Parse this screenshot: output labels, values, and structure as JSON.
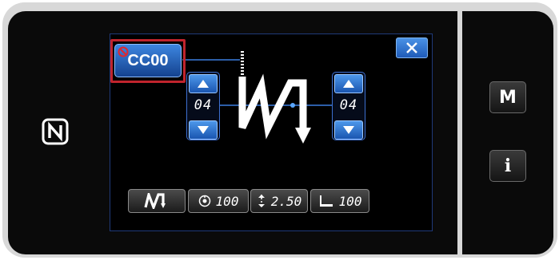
{
  "side": {
    "menu_label": "M",
    "info_label": "i"
  },
  "pattern_button": {
    "label": "CC00"
  },
  "steppers": {
    "left_value": "04",
    "right_value": "04"
  },
  "bottom_bar": {
    "speed_value": "100",
    "pitch_value": "2.50",
    "presser_value": "100"
  },
  "icons": {
    "nfc": "nfc-icon",
    "close": "close-icon",
    "prohibited": "no-entry-icon",
    "up": "triangle-up-icon",
    "down": "triangle-down-icon",
    "stitch": "zigzag-stitch-icon",
    "speed": "sewing-speed-icon",
    "pitch": "stitch-pitch-icon",
    "presser": "presser-foot-icon"
  },
  "colors": {
    "accent_blue": "#2f74d4",
    "highlight_red": "#c0242d",
    "screen_bg": "#000000"
  }
}
